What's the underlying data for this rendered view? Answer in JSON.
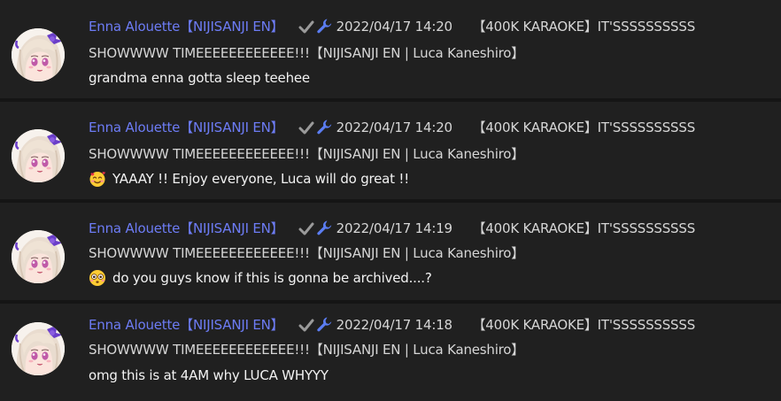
{
  "messages": [
    {
      "author": "Enna Alouette【NIJISANJI EN】",
      "badges": [
        "verified-check-icon",
        "wrench-icon"
      ],
      "timestamp": "2022/04/17 14:20",
      "title_line1": "【400K KARAOKE】IT'SSSSSSSSSS",
      "title_line2": "SHOWWWW TIMEEEEEEEEEEEE!!!【NIJISANJI EN | Luca Kaneshiro】",
      "emoji": "",
      "text": "grandma enna gotta sleep teehee"
    },
    {
      "author": "Enna Alouette【NIJISANJI EN】",
      "badges": [
        "verified-check-icon",
        "wrench-icon"
      ],
      "timestamp": "2022/04/17 14:20",
      "title_line1": "【400K KARAOKE】IT'SSSSSSSSSS",
      "title_line2": "SHOWWWW TIMEEEEEEEEEEEE!!!【NIJISANJI EN | Luca Kaneshiro】",
      "emoji": "smiling-face-with-hearts-emoji",
      "text": "YAAAY !! Enjoy everyone, Luca will do great !!"
    },
    {
      "author": "Enna Alouette【NIJISANJI EN】",
      "badges": [
        "verified-check-icon",
        "wrench-icon"
      ],
      "timestamp": "2022/04/17 14:19",
      "title_line1": "【400K KARAOKE】IT'SSSSSSSSSS",
      "title_line2": "SHOWWWW TIMEEEEEEEEEEEE!!!【NIJISANJI EN | Luca Kaneshiro】",
      "emoji": "flushed-face-emoji",
      "text": "do you guys know if this is gonna be archived....?"
    },
    {
      "author": "Enna Alouette【NIJISANJI EN】",
      "badges": [
        "verified-check-icon",
        "wrench-icon"
      ],
      "timestamp": "2022/04/17 14:18",
      "title_line1": "【400K KARAOKE】IT'SSSSSSSSSS",
      "title_line2": "SHOWWWW TIMEEEEEEEEEEEE!!!【NIJISANJI EN | Luca Kaneshiro】",
      "emoji": "",
      "text": "omg this is at 4AM why LUCA WHYYY"
    }
  ],
  "colors": {
    "author": "#6d7cf5",
    "background": "#202020",
    "separator": "#151515",
    "badge": "#9a9a9a",
    "wrench": "#5b7df2"
  }
}
